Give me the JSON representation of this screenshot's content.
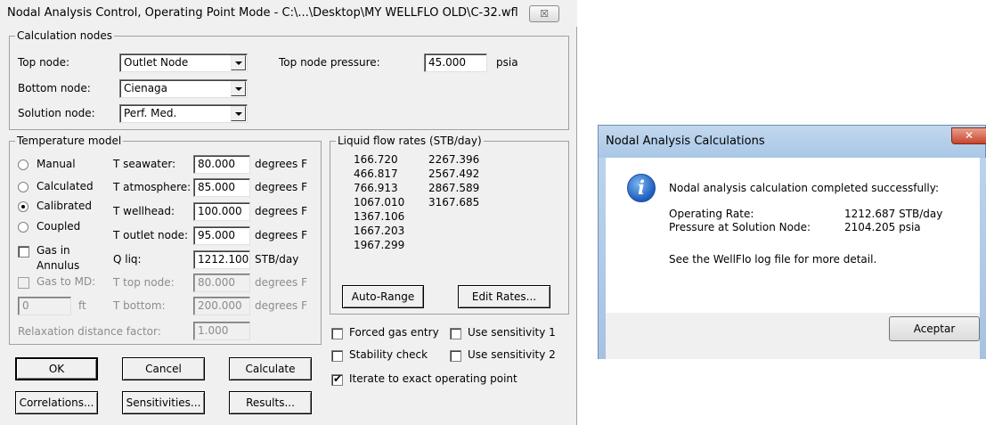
{
  "main_dialog": {
    "title": "Nodal Analysis Control, Operating Point Mode - C:\\...\\Desktop\\MY WELLFLO OLD\\C-32.wfl",
    "close_glyph": "☒",
    "calc_nodes": {
      "legend": "Calculation nodes",
      "top_node_label": "Top node:",
      "top_node_value": "Outlet Node",
      "bottom_node_label": "Bottom node:",
      "bottom_node_value": "Cienaga",
      "solution_node_label": "Solution node:",
      "solution_node_value": "Perf. Med.",
      "top_pressure_label": "Top node pressure:",
      "top_pressure_value": "45.000",
      "top_pressure_unit": "psia"
    },
    "temperature": {
      "legend": "Temperature model",
      "radios": [
        "Manual",
        "Calculated",
        "Calibrated",
        "Coupled"
      ],
      "selected": "Calibrated",
      "gas_in_annulus_line1": "Gas in",
      "gas_in_annulus_line2": "Annulus",
      "gas_to_md": "Gas to MD:",
      "md_value": "0",
      "md_unit": "ft",
      "relaxation_label": "Relaxation distance factor:",
      "relaxation_value": "1.000",
      "fields": {
        "t_seawater_label": "T seawater:",
        "t_seawater_value": "80.000",
        "t_seawater_unit": "degrees F",
        "t_atmosphere_label": "T atmosphere:",
        "t_atmosphere_value": "85.000",
        "t_atmosphere_unit": "degrees F",
        "t_wellhead_label": "T wellhead:",
        "t_wellhead_value": "100.000",
        "t_wellhead_unit": "degrees F",
        "t_outlet_label": "T outlet node:",
        "t_outlet_value": "95.000",
        "t_outlet_unit": "degrees F",
        "q_liq_label": "Q liq:",
        "q_liq_value": "1212.100",
        "q_liq_unit": "STB/day",
        "t_top_label": "T top node:",
        "t_top_value": "80.000",
        "t_top_unit": "degrees F",
        "t_bottom_label": "T bottom:",
        "t_bottom_value": "200.000",
        "t_bottom_unit": "degrees F"
      }
    },
    "flow_rates": {
      "legend": "Liquid flow rates (STB/day)",
      "col1": [
        "166.720",
        "466.817",
        "766.913",
        "1067.010",
        "1367.106",
        "1667.203",
        "1967.299"
      ],
      "col2": [
        "2267.396",
        "2567.492",
        "2867.589",
        "3167.685"
      ],
      "auto_range": "Auto-Range",
      "edit_rates": "Edit Rates..."
    },
    "options": {
      "forced_gas": "Forced gas entry",
      "stability": "Stability check",
      "iterate": "Iterate to exact operating point",
      "sens1": "Use sensitivity 1",
      "sens2": "Use sensitivity 2",
      "tick": "✔"
    },
    "buttons": {
      "ok": "OK",
      "cancel": "Cancel",
      "calculate": "Calculate",
      "correlations": "Correlations...",
      "sensitivities": "Sensitivities...",
      "results": "Results..."
    }
  },
  "result_dialog": {
    "title": "Nodal Analysis Calculations",
    "close_glyph": "✕",
    "icon_glyph": "i",
    "message": "Nodal analysis calculation completed successfully:",
    "operating_rate_label": "Operating Rate:",
    "operating_rate_value": "1212.687 STB/day",
    "pressure_label": "Pressure at Solution Node:",
    "pressure_value": "2104.205 psia",
    "log_note": "See the WellFlo log file for more detail.",
    "accept": "Aceptar"
  },
  "colors": {
    "dialog_bg": "#f0f0f0",
    "title_blue": "#b4cfea",
    "close_red": "#c8452c",
    "info_blue": "#1c5cbd"
  }
}
